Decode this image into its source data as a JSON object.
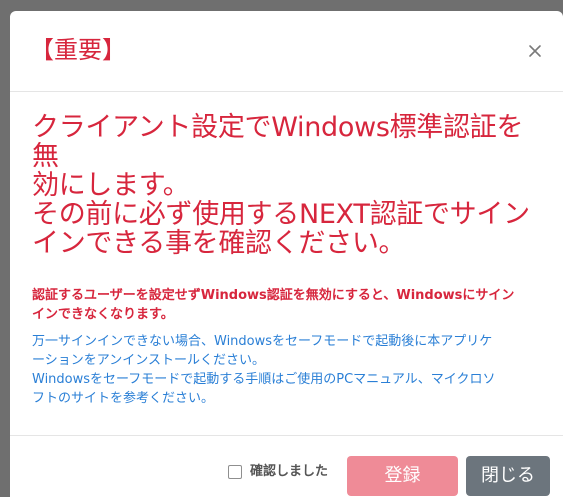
{
  "dialog": {
    "title": "【重要】",
    "headline": "クライアント設定でWindows標準認証を無\n効にします。\nその前に必ず使用するNEXT認証でサイン\nインできる事を確認ください。",
    "warning": "認証するユーザーを設定せずWindows認証を無効にすると、Windowsにサイン\nインできなくなります。",
    "note": "万一サインインできない場合、Windowsをセーフモードで起動後に本アプリケ\nーションをアンインストールください。\nWindowsをセーフモードで起動する手順はご使用のPCマニュアル、マイクロソ\nフトのサイトを参考ください。"
  },
  "footer": {
    "checkbox_label": "確認しました",
    "register_label": "登録",
    "close_label": "閉じる"
  },
  "icons": {
    "close": "close-icon"
  },
  "colors": {
    "red_text": "#d7263d",
    "blue_text": "#2a7fd6",
    "register_button": "#ef8b97",
    "close_button": "#6c757d",
    "backdrop": "#7b7b7b"
  }
}
